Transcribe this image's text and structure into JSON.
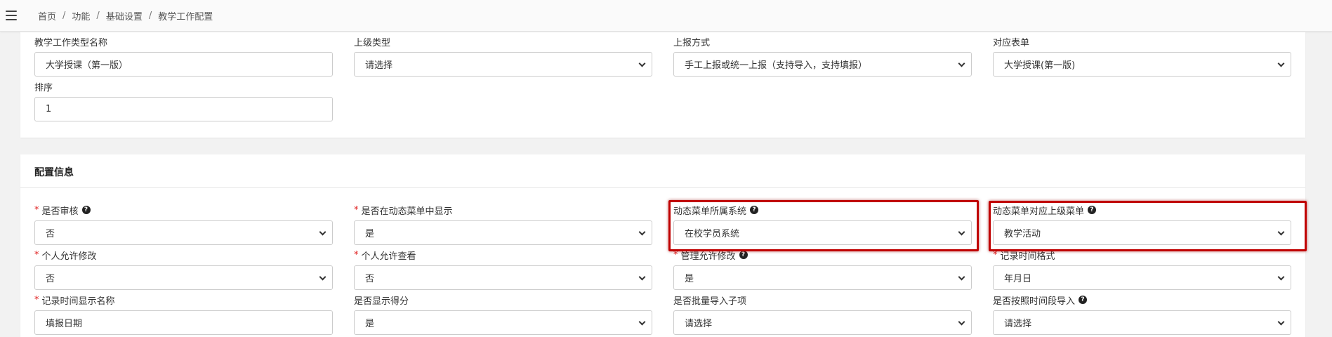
{
  "breadcrumb": [
    "首页",
    "功能",
    "基础设置",
    "教学工作配置"
  ],
  "basic": {
    "type_name": {
      "label": "教学工作类型名称",
      "value": "大学授课（第一版）"
    },
    "parent_type": {
      "label": "上级类型",
      "value": "请选择"
    },
    "report_method": {
      "label": "上报方式",
      "value": "手工上报或统一上报（支持导入，支持填报）"
    },
    "form": {
      "label": "对应表单",
      "value": "大学授课(第一版)"
    },
    "sort": {
      "label": "排序",
      "value": "1"
    }
  },
  "config": {
    "title": "配置信息",
    "audit": {
      "label": "是否审核",
      "value": "否"
    },
    "show_in_menu": {
      "label": "是否在动态菜单中显示",
      "value": "是"
    },
    "menu_system": {
      "label": "动态菜单所属系统",
      "value": "在校学员系统"
    },
    "menu_parent": {
      "label": "动态菜单对应上级菜单",
      "value": "教学活动"
    },
    "personal_edit": {
      "label": "个人允许修改",
      "value": "否"
    },
    "personal_view": {
      "label": "个人允许查看",
      "value": "否"
    },
    "admin_edit": {
      "label": "管理允许修改",
      "value": "是"
    },
    "time_format": {
      "label": "记录时间格式",
      "value": "年月日"
    },
    "time_name": {
      "label": "记录时间显示名称",
      "value": "填报日期"
    },
    "show_score": {
      "label": "是否显示得分",
      "value": "是"
    },
    "batch_import": {
      "label": "是否批量导入子项",
      "value": "请选择"
    },
    "period_import": {
      "label": "是否按照时间段导入",
      "value": "请选择"
    }
  },
  "colors": {
    "required": "#e02020",
    "highlight": "#c00000"
  },
  "icons": {
    "menu": "hamburger-icon",
    "help": "question-circle-icon",
    "dropdown": "chevron-down-icon"
  }
}
